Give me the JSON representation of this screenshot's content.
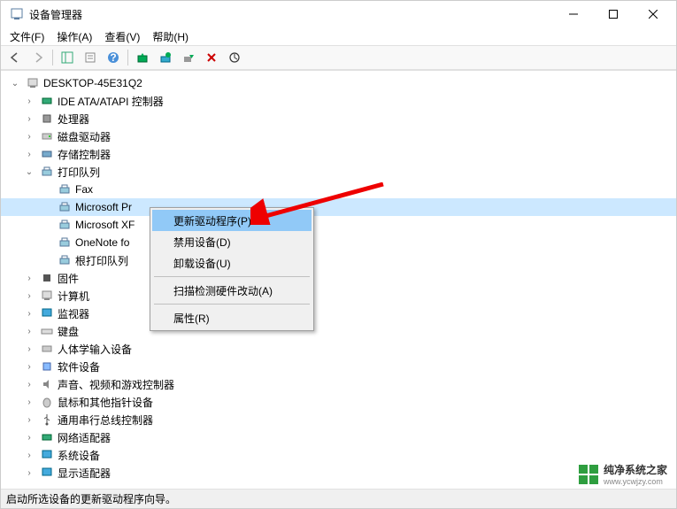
{
  "title": "设备管理器",
  "menus": {
    "file": "文件(F)",
    "action": "操作(A)",
    "view": "查看(V)",
    "help": "帮助(H)"
  },
  "tree": {
    "root": "DESKTOP-45E31Q2",
    "categories": [
      {
        "label": "IDE ATA/ATAPI 控制器",
        "expanded": false
      },
      {
        "label": "处理器",
        "expanded": false
      },
      {
        "label": "磁盘驱动器",
        "expanded": false
      },
      {
        "label": "存储控制器",
        "expanded": false
      },
      {
        "label": "打印队列",
        "expanded": true,
        "children": [
          {
            "label": "Fax"
          },
          {
            "label": "Microsoft Pr",
            "selected": true
          },
          {
            "label": "Microsoft XF"
          },
          {
            "label": "OneNote fo"
          },
          {
            "label": "根打印队列"
          }
        ]
      },
      {
        "label": "固件",
        "expanded": false
      },
      {
        "label": "计算机",
        "expanded": false
      },
      {
        "label": "监视器",
        "expanded": false
      },
      {
        "label": "键盘",
        "expanded": false
      },
      {
        "label": "人体学输入设备",
        "expanded": false
      },
      {
        "label": "软件设备",
        "expanded": false
      },
      {
        "label": "声音、视频和游戏控制器",
        "expanded": false
      },
      {
        "label": "鼠标和其他指针设备",
        "expanded": false
      },
      {
        "label": "通用串行总线控制器",
        "expanded": false
      },
      {
        "label": "网络适配器",
        "expanded": false
      },
      {
        "label": "系统设备",
        "expanded": false
      },
      {
        "label": "显示适配器",
        "expanded": false
      }
    ]
  },
  "context_menu": {
    "update_driver": "更新驱动程序(P)",
    "disable": "禁用设备(D)",
    "uninstall": "卸载设备(U)",
    "scan": "扫描检测硬件改动(A)",
    "properties": "属性(R)"
  },
  "statusbar": "启动所选设备的更新驱动程序向导。",
  "watermark": {
    "name": "纯净系统之家",
    "url": "www.ycwjzy.com"
  }
}
